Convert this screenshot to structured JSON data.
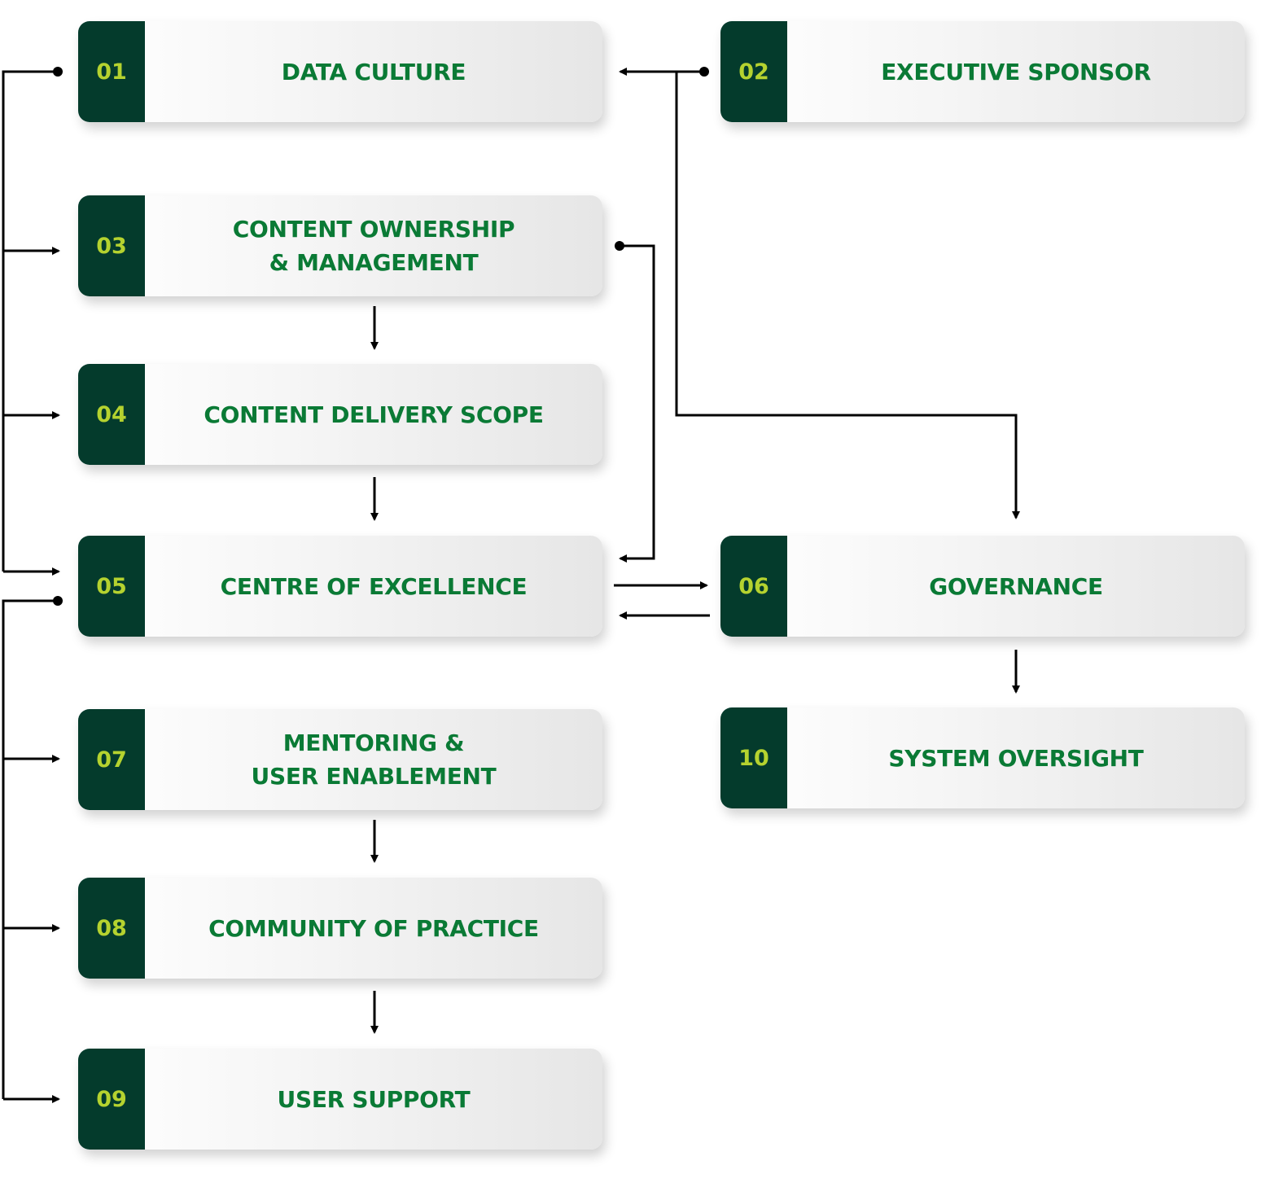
{
  "colors": {
    "number_panel": "#043b2c",
    "number_text": "#b5d22f",
    "label_text": "#0a7a35",
    "connector": "#000000"
  },
  "nodes": [
    {
      "id": "01",
      "number": "01",
      "label": "DATA CULTURE"
    },
    {
      "id": "02",
      "number": "02",
      "label": "EXECUTIVE SPONSOR"
    },
    {
      "id": "03",
      "number": "03",
      "label": "CONTENT OWNERSHIP\n& MANAGEMENT"
    },
    {
      "id": "04",
      "number": "04",
      "label": "CONTENT DELIVERY SCOPE"
    },
    {
      "id": "05",
      "number": "05",
      "label": "CENTRE OF EXCELLENCE"
    },
    {
      "id": "06",
      "number": "06",
      "label": "GOVERNANCE"
    },
    {
      "id": "07",
      "number": "07",
      "label": "MENTORING &\nUSER ENABLEMENT"
    },
    {
      "id": "08",
      "number": "08",
      "label": "COMMUNITY OF PRACTICE"
    },
    {
      "id": "09",
      "number": "09",
      "label": "USER SUPPORT"
    },
    {
      "id": "10",
      "number": "10",
      "label": "SYSTEM OVERSIGHT"
    }
  ],
  "edges": [
    {
      "from": "01",
      "to": "03"
    },
    {
      "from": "01",
      "to": "04"
    },
    {
      "from": "01",
      "to": "05"
    },
    {
      "from": "02",
      "to": "01"
    },
    {
      "from": "02",
      "to": "06"
    },
    {
      "from": "03",
      "to": "04"
    },
    {
      "from": "03",
      "to": "05"
    },
    {
      "from": "04",
      "to": "05"
    },
    {
      "from": "05",
      "to": "06"
    },
    {
      "from": "06",
      "to": "05"
    },
    {
      "from": "05",
      "to": "07"
    },
    {
      "from": "05",
      "to": "08"
    },
    {
      "from": "05",
      "to": "09"
    },
    {
      "from": "06",
      "to": "10"
    },
    {
      "from": "07",
      "to": "08"
    },
    {
      "from": "08",
      "to": "09"
    }
  ]
}
